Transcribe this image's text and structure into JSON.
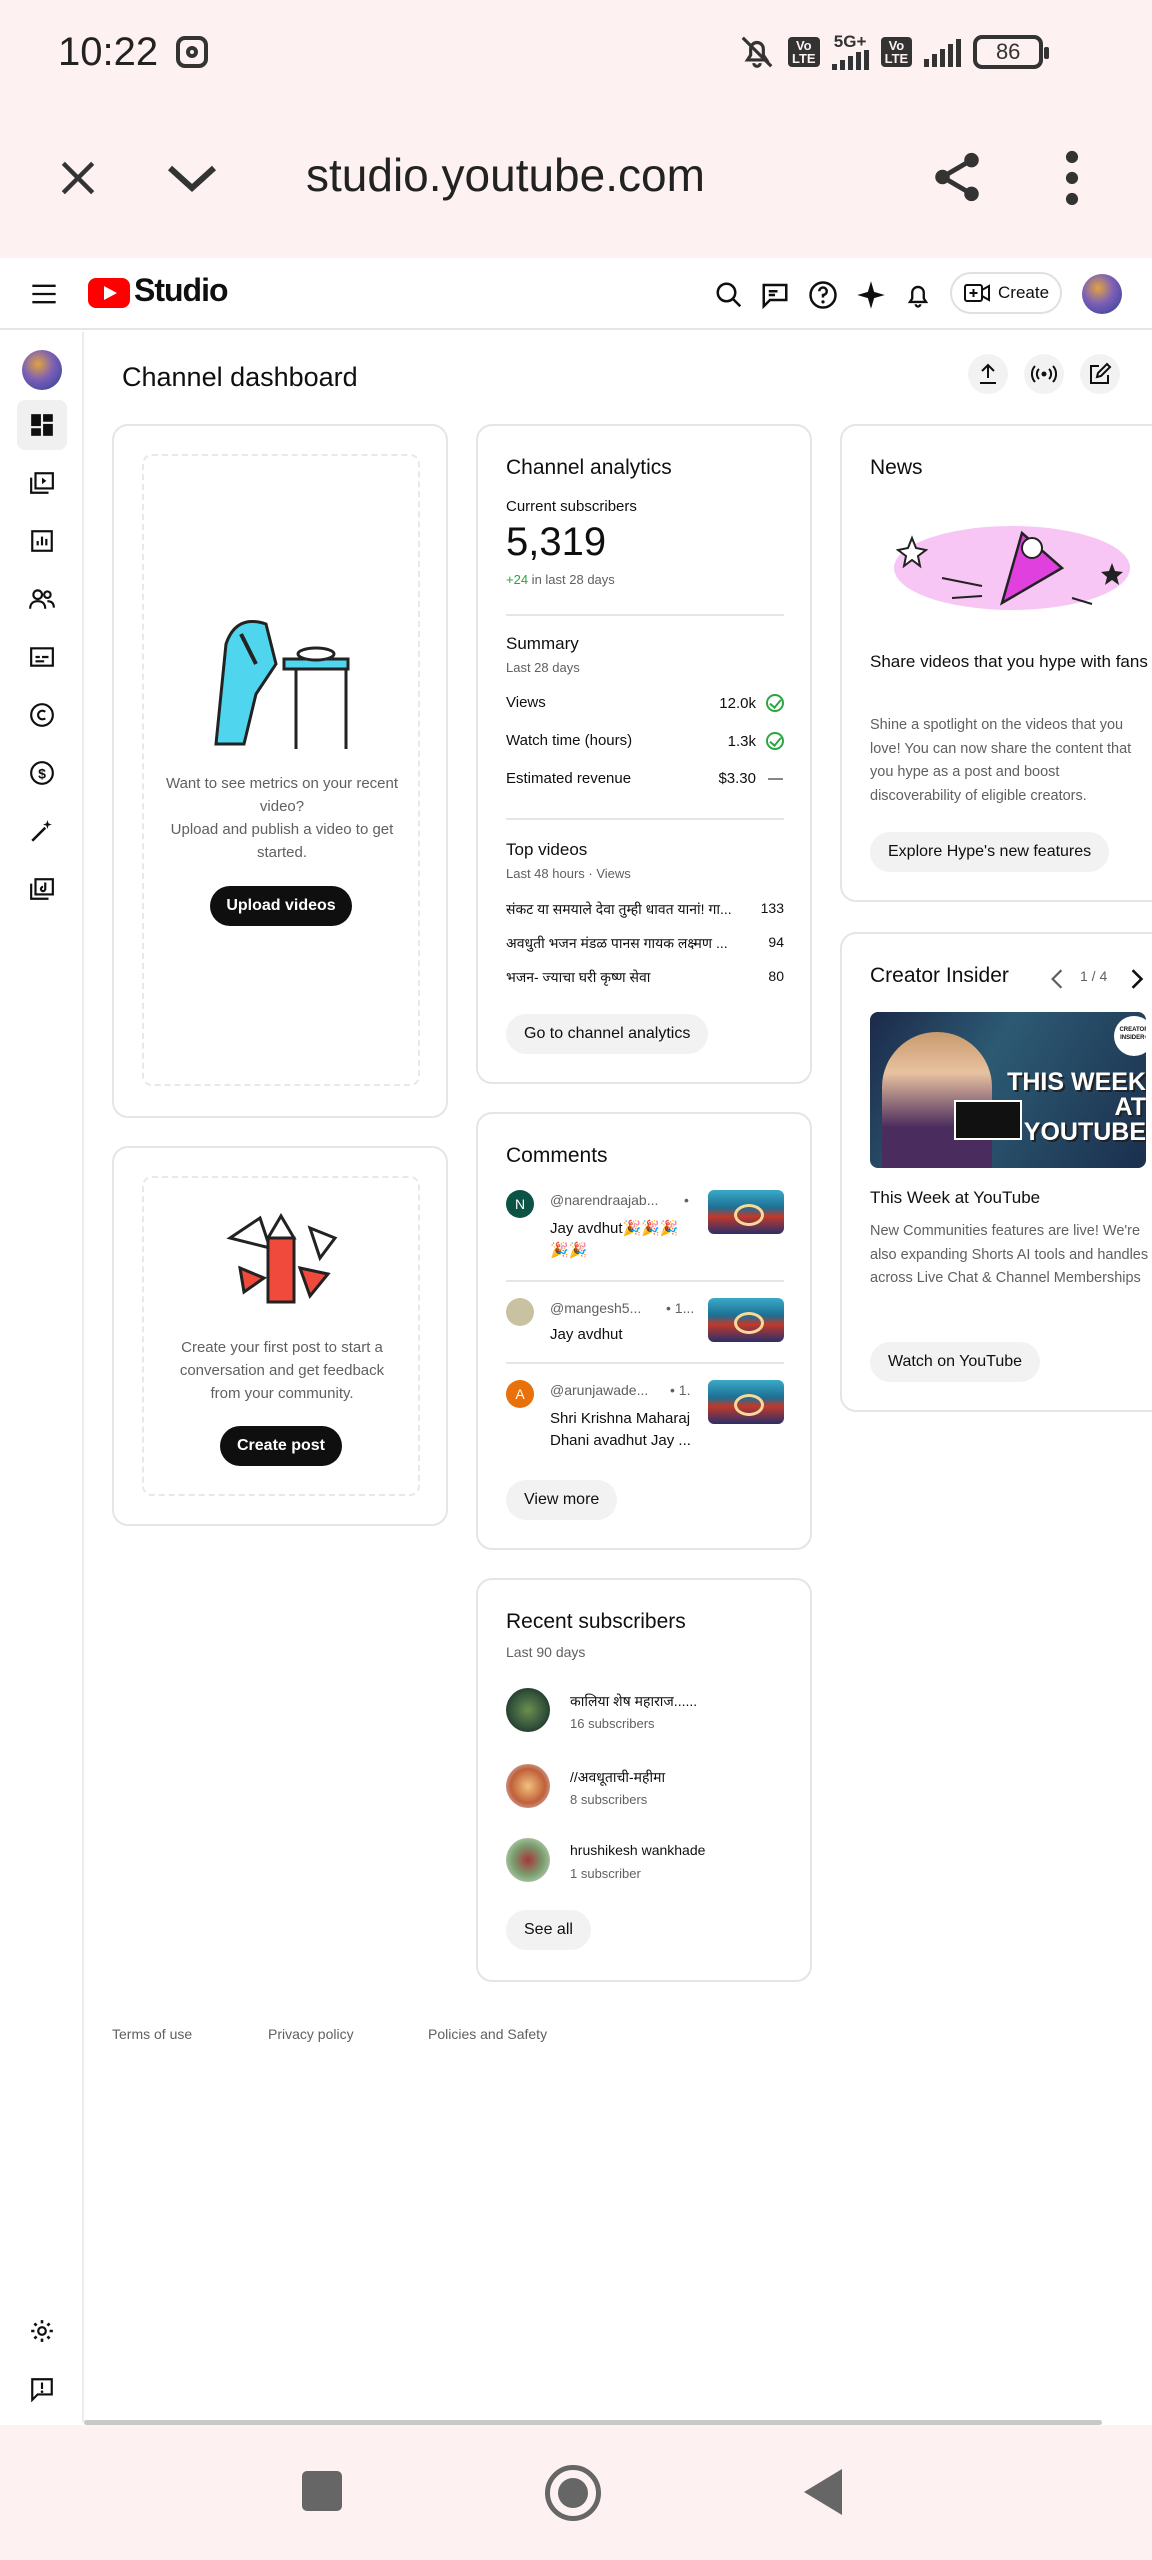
{
  "status_bar": {
    "time": "10:22",
    "network": "5G+",
    "volte_label": "Vo\nLTE",
    "battery": "86"
  },
  "browser": {
    "url": "studio.youtube.com"
  },
  "header": {
    "logo_text": "Studio",
    "create_label": "Create"
  },
  "dashboard": {
    "title": "Channel dashboard",
    "upload_card": {
      "text_line1": "Want to see metrics on your recent video?",
      "text_line2": "Upload and publish a video to get started.",
      "button": "Upload videos"
    },
    "post_card": {
      "text": "Create your first post to start a conversation and get feedback from your community.",
      "button": "Create post"
    },
    "analytics": {
      "title": "Channel analytics",
      "subs_label": "Current subscribers",
      "subs_value": "5,319",
      "subs_change_num": "+24",
      "subs_change_text": " in last 28 days",
      "summary_title": "Summary",
      "summary_period": "Last 28 days",
      "rows": [
        {
          "label": "Views",
          "value": "12.0k"
        },
        {
          "label": "Watch time (hours)",
          "value": "1.3k"
        },
        {
          "label": "Estimated revenue",
          "value": "$3.30",
          "trend": "—"
        }
      ],
      "top_title": "Top videos",
      "top_period": "Last 48 hours · Views",
      "top_videos": [
        {
          "title": "संकट या समयाले देवा तुम्ही धावत यानां! गा...",
          "views": "133"
        },
        {
          "title": "अवधुती भजन मंडळ पानस गायक लक्ष्मण ...",
          "views": "94"
        },
        {
          "title": "भजन- ज्याचा घरी कृष्ण सेवा",
          "views": "80"
        }
      ],
      "button": "Go to channel analytics"
    },
    "comments": {
      "title": "Comments",
      "items": [
        {
          "initial": "N",
          "author": "@narendraajab...",
          "meta": "•",
          "text_line1": "Jay avdhut🎉🎉🎉",
          "text_line2": "🎉🎉"
        },
        {
          "initial": "",
          "author": "@mangesh5...",
          "meta": "• 1...",
          "text_line1": "Jay avdhut",
          "text_line2": ""
        },
        {
          "initial": "A",
          "author": "@arunjawade...",
          "meta": "• 1.",
          "text_line1": "Shri Krishna Maharaj",
          "text_line2": "Dhani avadhut Jay ..."
        }
      ],
      "button": "View more"
    },
    "recent_subs": {
      "title": "Recent subscribers",
      "period": "Last 90 days",
      "items": [
        {
          "name": "कालिया शेष महाराज......",
          "count": "16 subscribers"
        },
        {
          "name": "//अवधूताची-महीमा",
          "count": "8 subscribers"
        },
        {
          "name": "hrushikesh wankhade",
          "count": "1 subscriber"
        }
      ],
      "button": "See all"
    },
    "news": {
      "title": "News",
      "headline": "Share videos that you hype with fans",
      "body": "Shine a spotlight on the videos that you love! You can now share the content that you hype as a post and boost discoverability of eligible creators.",
      "button": "Explore Hype's new features"
    },
    "insider": {
      "title": "Creator Insider",
      "pager": "1 / 4",
      "thumb_badge": "CREATOR INSIDER+",
      "thumb_text": "THIS WEEK AT YOUTUBE",
      "headline": "This Week at YouTube",
      "body": "New Communities features are live! We're also expanding Shorts AI tools and handles across Live Chat & Channel Memberships",
      "button": "Watch on YouTube"
    }
  },
  "footer": {
    "links": [
      "Terms of use",
      "Privacy policy",
      "Policies and Safety"
    ]
  },
  "colors": {
    "brand_red": "#ff0000",
    "positive_green": "#2ba640",
    "status_bg": "#fdf1f1"
  }
}
